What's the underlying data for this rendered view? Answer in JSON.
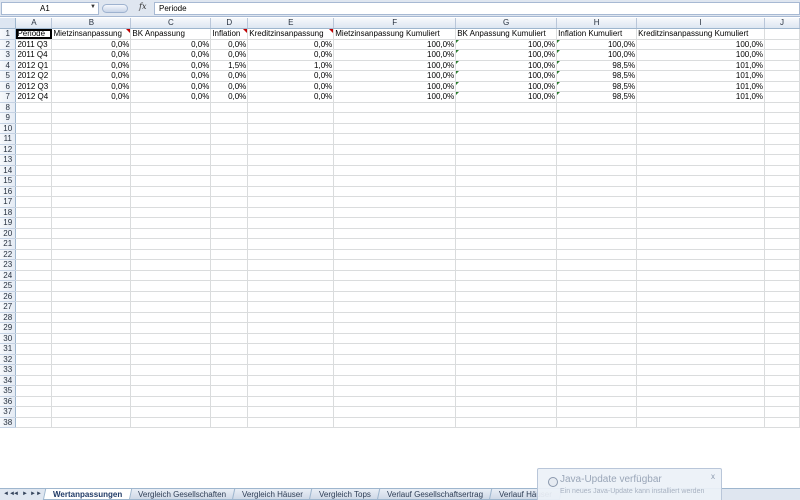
{
  "formula_bar": {
    "name_box": "A1",
    "fx_label": "fx",
    "content": "Periode"
  },
  "sheet": {
    "columns": [
      "A",
      "B",
      "C",
      "D",
      "E",
      "F",
      "G",
      "H",
      "I",
      "J"
    ],
    "rows": [
      [
        "Periode",
        "Mietzinsanpassung",
        "BK Anpassung",
        "Inflation",
        "Kreditzinsanpassung",
        "Mietzinsanpassung Kumuliert",
        "BK Anpassung Kumuliert",
        "Inflation Kumuliert",
        "Kreditzinsanpassung Kumuliert",
        ""
      ],
      [
        "2011 Q3",
        "0,0%",
        "0,0%",
        "0,0%",
        "0,0%",
        "100,0%",
        "100,0%",
        "100,0%",
        "100,0%",
        ""
      ],
      [
        "2011 Q4",
        "0,0%",
        "0,0%",
        "0,0%",
        "0,0%",
        "100,0%",
        "100,0%",
        "100,0%",
        "100,0%",
        ""
      ],
      [
        "2012 Q1",
        "0,0%",
        "0,0%",
        "1,5%",
        "1,0%",
        "100,0%",
        "100,0%",
        "98,5%",
        "101,0%",
        ""
      ],
      [
        "2012 Q2",
        "0,0%",
        "0,0%",
        "0,0%",
        "0,0%",
        "100,0%",
        "100,0%",
        "98,5%",
        "101,0%",
        ""
      ],
      [
        "2012 Q3",
        "0,0%",
        "0,0%",
        "0,0%",
        "0,0%",
        "100,0%",
        "100,0%",
        "98,5%",
        "101,0%",
        ""
      ],
      [
        "2012 Q4",
        "0,0%",
        "0,0%",
        "0,0%",
        "0,0%",
        "100,0%",
        "100,0%",
        "98,5%",
        "101,0%",
        ""
      ]
    ],
    "total_rows": 38
  },
  "tab_nav": [
    "◄◄",
    "◄",
    "►",
    "►►"
  ],
  "tabs": [
    {
      "label": "Wertanpassungen",
      "active": true
    },
    {
      "label": "Vergleich Gesellschaften",
      "active": false
    },
    {
      "label": "Vergleich Häuser",
      "active": false
    },
    {
      "label": "Vergleich Tops",
      "active": false
    },
    {
      "label": "Verlauf Gesellschaftsertrag",
      "active": false
    },
    {
      "label": "Verlauf Häuser",
      "active": false
    }
  ],
  "notification": {
    "title": "Java-Update verfügbar",
    "body": "Ein neues Java-Update kann installiert werden",
    "close": "x",
    "icon": "java-update-icon"
  }
}
